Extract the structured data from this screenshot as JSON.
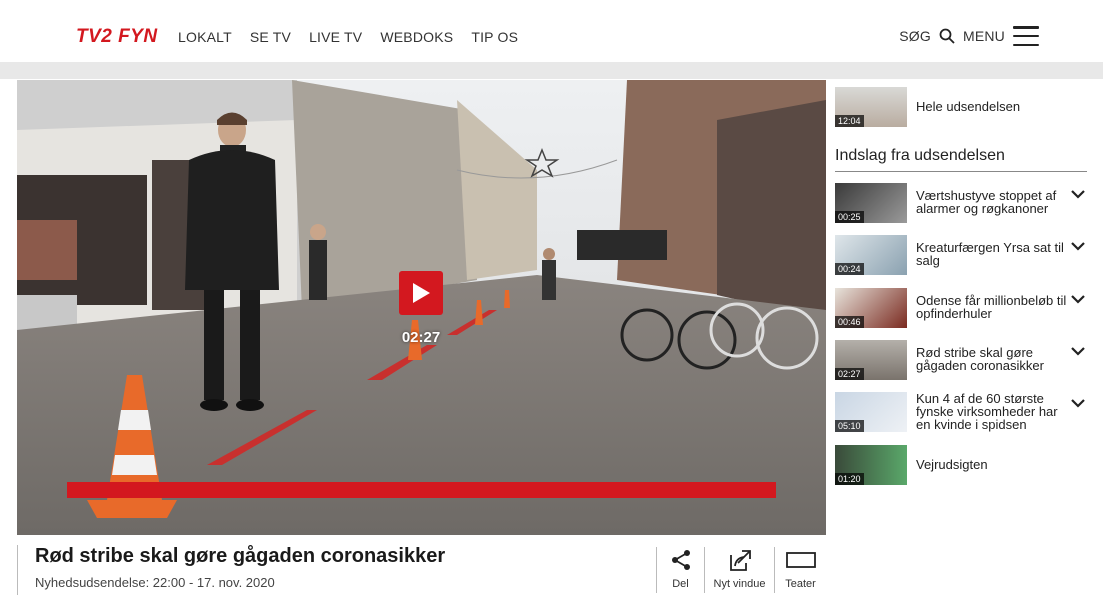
{
  "header": {
    "logo_text": "TV2 FYN",
    "nav": [
      "LOKALT",
      "SE TV",
      "LIVE TV",
      "WEBDOKS",
      "TIP OS"
    ],
    "search_label": "SØG",
    "menu_label": "MENU"
  },
  "video": {
    "duration": "02:27",
    "title": "Rød stribe skal gøre gågaden coronasikker",
    "subtitle": "Nyhedsudsendelse: 22:00 - 17. nov. 2020"
  },
  "actions": [
    {
      "label": "Del",
      "icon": "share-icon"
    },
    {
      "label": "Nyt vindue",
      "icon": "new-window-icon"
    },
    {
      "label": "Teater",
      "icon": "theater-icon"
    }
  ],
  "sidebar": {
    "full_episode": {
      "duration": "12:04",
      "label": "Hele udsendelsen"
    },
    "section_heading": "Indslag fra udsendelsen",
    "segments": [
      {
        "duration": "00:25",
        "line1": "Værtshustyve stoppet af",
        "line2": "alarmer og røgkanoner",
        "line3": ""
      },
      {
        "duration": "00:24",
        "line1": "Kreaturfærgen Yrsa sat til",
        "line2": "salg",
        "line3": ""
      },
      {
        "duration": "00:46",
        "line1": "Odense får millionbeløb til",
        "line2": "opfinderhuler",
        "line3": ""
      },
      {
        "duration": "02:27",
        "line1": "Rød stribe skal gøre",
        "line2": "gågaden coronasikker",
        "line3": ""
      },
      {
        "duration": "05:10",
        "line1": "Kun 4 af de 60 største",
        "line2": "fynske virksomheder har",
        "line3": "en kvinde i spidsen"
      },
      {
        "duration": "01:20",
        "line1": "Vejrudsigten",
        "line2": "",
        "line3": ""
      }
    ]
  },
  "colors": {
    "brand": "#d3181f"
  }
}
